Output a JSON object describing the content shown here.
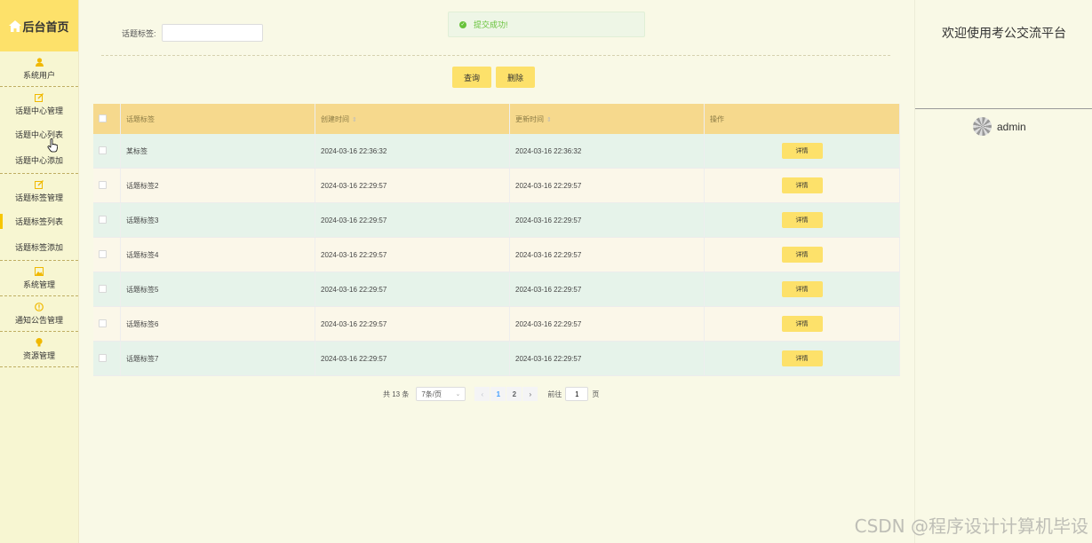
{
  "sidebar": {
    "logo": "后台首页",
    "groups": [
      {
        "label": "系统用户",
        "icon": "person-icon",
        "items": []
      },
      {
        "label": "话题中心管理",
        "icon": "edit-icon",
        "items": [
          "话题中心列表",
          "话题中心添加"
        ]
      },
      {
        "label": "话题标签管理",
        "icon": "edit-icon",
        "items": [
          "话题标签列表",
          "话题标签添加"
        ]
      },
      {
        "label": "系统管理",
        "icon": "image-icon",
        "items": []
      },
      {
        "label": "通知公告管理",
        "icon": "info-icon",
        "items": []
      },
      {
        "label": "资源管理",
        "icon": "bulb-icon",
        "items": []
      }
    ],
    "accent": "#fde16a"
  },
  "toast": {
    "message": "提交成功!",
    "color": "#67c23a"
  },
  "search": {
    "label": "话题标签:",
    "value": ""
  },
  "buttons": {
    "query": "查询",
    "delete": "删除"
  },
  "table": {
    "headers": {
      "tag": "话题标签",
      "created": "创建时间",
      "updated": "更新时间",
      "action": "操作"
    },
    "detail_label": "详情",
    "rows": [
      {
        "tag": "某标签",
        "created": "2024-03-16 22:36:32",
        "updated": "2024-03-16 22:36:32"
      },
      {
        "tag": "话题标签2",
        "created": "2024-03-16 22:29:57",
        "updated": "2024-03-16 22:29:57"
      },
      {
        "tag": "话题标签3",
        "created": "2024-03-16 22:29:57",
        "updated": "2024-03-16 22:29:57"
      },
      {
        "tag": "话题标签4",
        "created": "2024-03-16 22:29:57",
        "updated": "2024-03-16 22:29:57"
      },
      {
        "tag": "话题标签5",
        "created": "2024-03-16 22:29:57",
        "updated": "2024-03-16 22:29:57"
      },
      {
        "tag": "话题标签6",
        "created": "2024-03-16 22:29:57",
        "updated": "2024-03-16 22:29:57"
      },
      {
        "tag": "话题标签7",
        "created": "2024-03-16 22:29:57",
        "updated": "2024-03-16 22:29:57"
      }
    ]
  },
  "pagination": {
    "total": "共 13 条",
    "page_size": "7条/页",
    "pages": [
      "1",
      "2"
    ],
    "current": "1",
    "goto_label": "前往",
    "goto_value": "1",
    "page_suffix": "页"
  },
  "header_right": {
    "welcome": "欢迎使用考公交流平台",
    "username": "admin"
  },
  "watermark": "CSDN @程序设计计算机毕设"
}
